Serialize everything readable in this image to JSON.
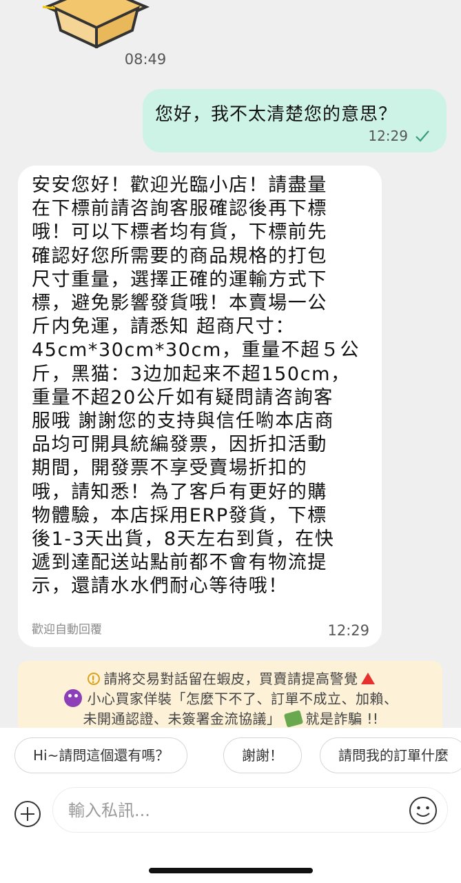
{
  "chat": {
    "timestamp": "08:49",
    "outgoing": {
      "text": "您好，我不太清楚您的意思？",
      "time": "12:29",
      "status_icon": "check-icon"
    },
    "incoming": {
      "text": "安安您好！歡迎光臨小店！請盡量\n在下標前請咨詢客服確認後再下標\n哦！可以下標者均有貨，下標前先\n確認好您所需要的商品規格的打包\n尺寸重量，選擇正確的運輸方式下\n標，避免影響發貨哦！本賣場一公\n斤内免運，請悉知 超商尺寸：\n45cm*30cm*30cm，重量不超５公\n斤，黑猫：3边加起来不超150cm，\n重量不超20公斤如有疑問請咨詢客\n服哦 謝謝您的支持與信任喲本店商\n品均可開具統編發票，因折扣活動\n期間，開發票不享受賣場折扣的\n哦，請知悉！為了客戶有更好的購\n物體驗，本店採用ERP發貨，下標\n後1-3天出貨，8天左右到貨，在快\n遞到達配送站點前都不會有物流提\n示，還請水水們耐心等待哦！",
      "label": "歡迎自動回覆",
      "time": "12:29"
    }
  },
  "notice": {
    "line1": "請將交易對話留在蝦皮，買賣請提高警覺",
    "line2": "小心買家佯裝「怎麼下不了、訂單不成立、加賴、",
    "line3_a": "未開通認證、未簽署金流協議」",
    "line3_b": "就是詐騙 !!",
    "colors": {
      "background": "#fdf1d8",
      "warning": "#e5322e"
    }
  },
  "quick_replies": [
    "Hi~請問這個還有嗎？",
    "謝謝！",
    "請問我的訂單什麼"
  ],
  "composer": {
    "placeholder": "輸入私訊..."
  },
  "colors": {
    "outgoing_bubble": "#cdf3e7",
    "incoming_bubble": "#ffffff",
    "chat_background": "#efefef"
  }
}
